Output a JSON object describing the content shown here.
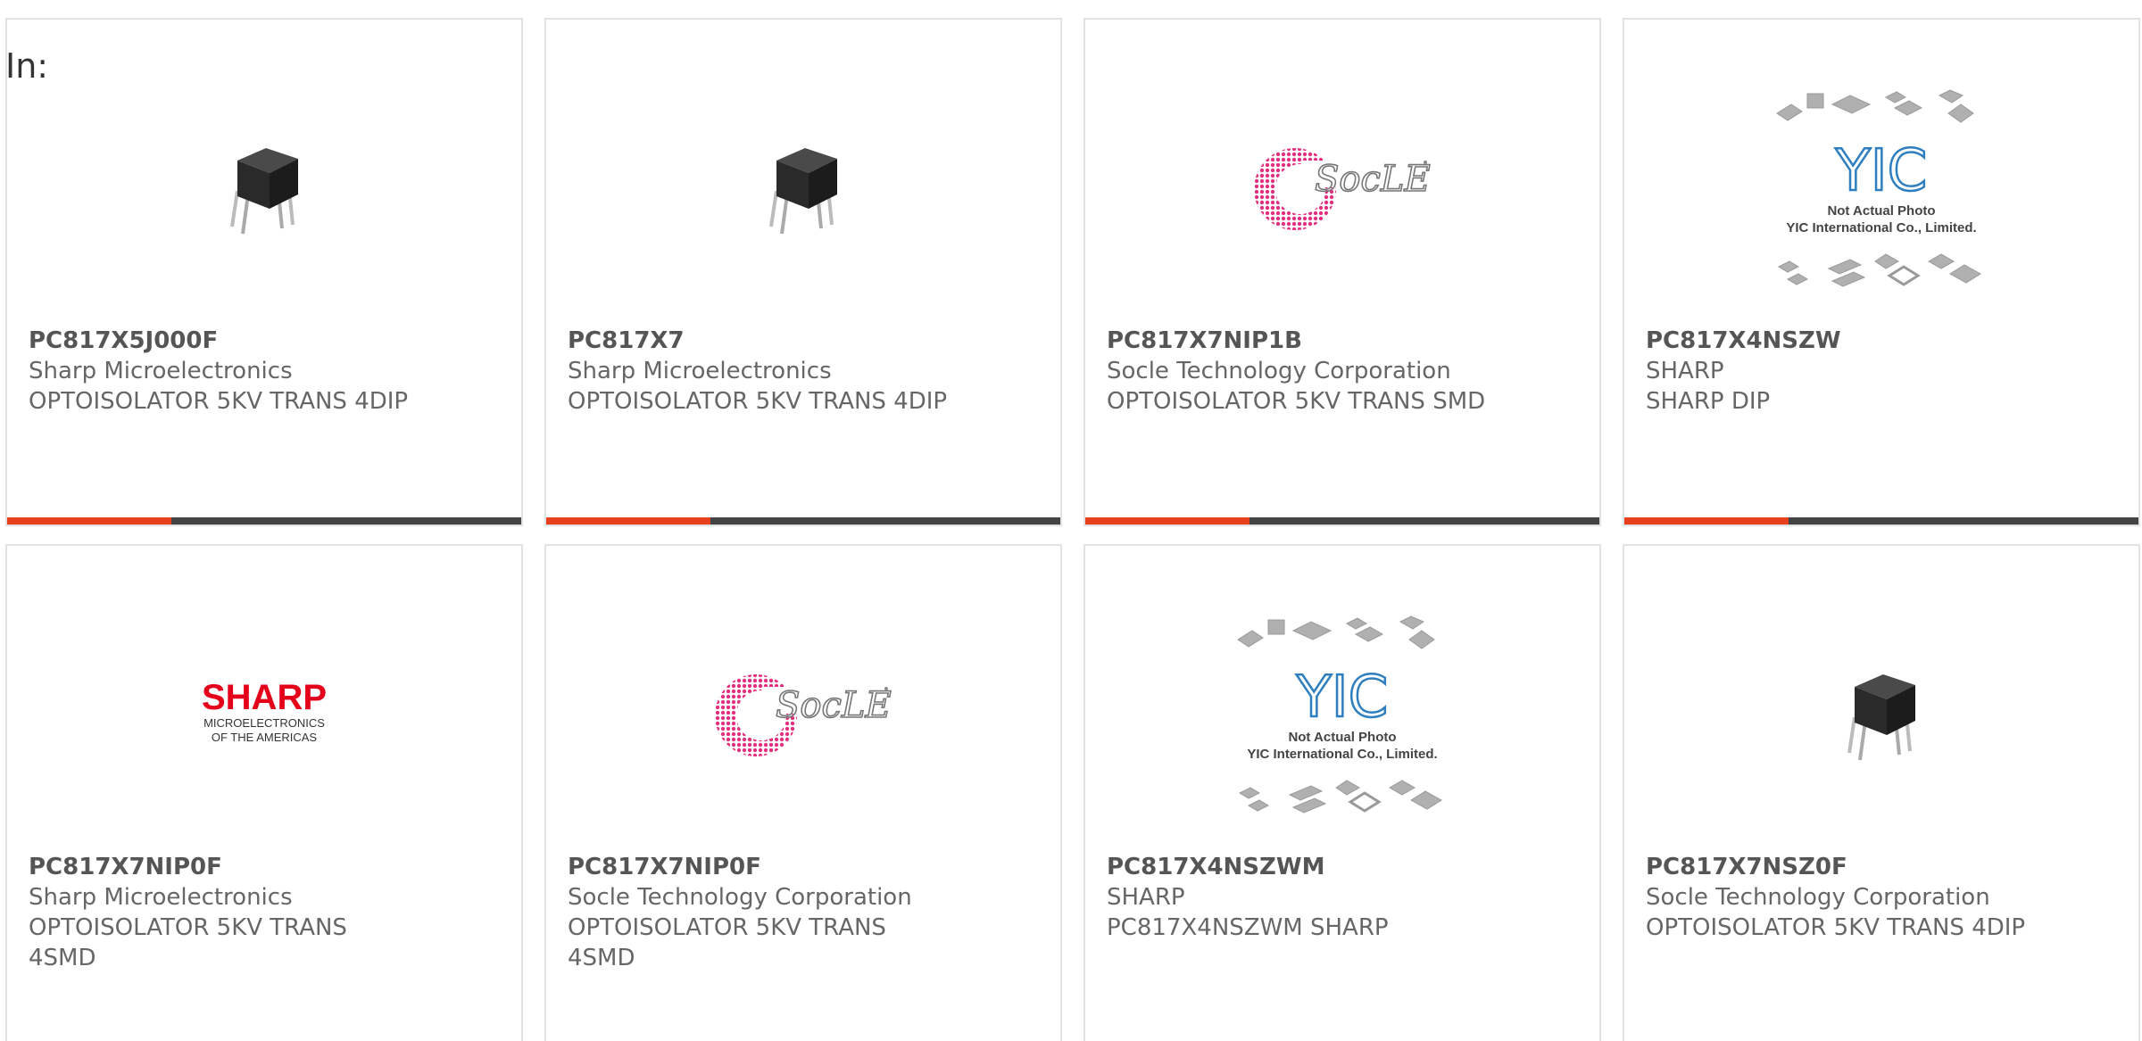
{
  "filter_label": "In:",
  "colors": {
    "accent": "#e8401c",
    "bar_dark": "#444444",
    "card_border": "#e2e2e2"
  },
  "products": [
    {
      "part": "PC817X5J000F",
      "manufacturer": "Sharp Microelectronics",
      "description": "OPTOISOLATOR 5KV TRANS 4DIP",
      "image": "dip-chip-icon"
    },
    {
      "part": "PC817X7",
      "manufacturer": "Sharp Microelectronics",
      "description": "OPTOISOLATOR 5KV TRANS 4DIP",
      "image": "dip-chip-icon"
    },
    {
      "part": "PC817X7NIP1B",
      "manufacturer": "Socle Technology Corporation",
      "description": "OPTOISOLATOR 5KV TRANS SMD",
      "image": "socle-logo"
    },
    {
      "part": "PC817X4NSZW",
      "manufacturer": "SHARP",
      "description": "SHARP DIP",
      "image": "yic-placeholder"
    },
    {
      "part": "PC817X7NIP0F",
      "manufacturer": "Sharp Microelectronics",
      "description": "OPTOISOLATOR 5KV TRANS 4SMD",
      "image": "sharp-logo"
    },
    {
      "part": "PC817X7NIP0F",
      "manufacturer": "Socle Technology Corporation",
      "description": "OPTOISOLATOR 5KV TRANS 4SMD",
      "image": "socle-logo"
    },
    {
      "part": "PC817X4NSZWM",
      "manufacturer": "SHARP",
      "description": "PC817X4NSZWM SHARP",
      "image": "yic-placeholder"
    },
    {
      "part": "PC817X7NSZ0F",
      "manufacturer": "Socle Technology Corporation",
      "description": "OPTOISOLATOR 5KV TRANS 4DIP",
      "image": "dip-chip-icon"
    }
  ],
  "logo_text": {
    "socle": "SocLE",
    "sharp_main": "SHARP",
    "sharp_sub1": "MICROELECTRONICS",
    "sharp_sub2": "OF THE AMERICAS",
    "yic_mark": "YIC",
    "yic_line1": "Not Actual Photo",
    "yic_line2": "YIC International Co., Limited."
  }
}
